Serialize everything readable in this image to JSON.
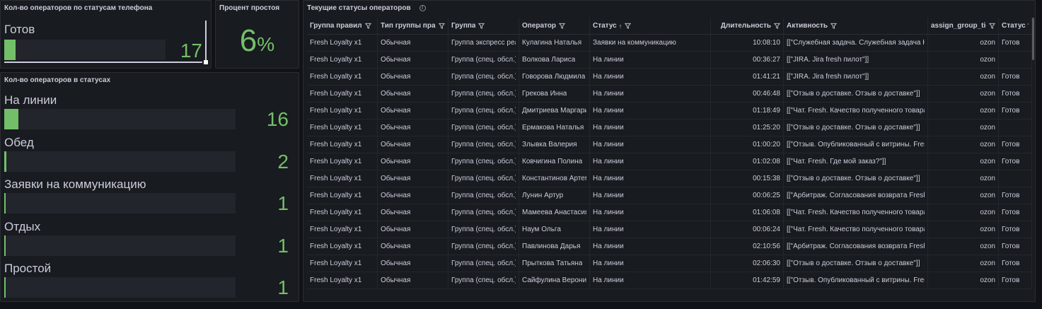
{
  "colors": {
    "accent": "#73bf69",
    "panel_bg": "#181b1f",
    "page_bg": "#111217"
  },
  "phone_status_panel": {
    "title": "Кол-во операторов по статусам телефона",
    "items": [
      {
        "label": "Готов",
        "value": "17",
        "fraction": 0.07
      }
    ]
  },
  "idle_panel": {
    "title": "Процент простоя",
    "value": "6",
    "unit": "%"
  },
  "status_panel": {
    "title": "Кол-во операторов в статусах",
    "items": [
      {
        "label": "На линии",
        "value": "16",
        "fraction": 0.06
      },
      {
        "label": "Обед",
        "value": "2",
        "fraction": 0.008
      },
      {
        "label": "Заявки на коммуникацию",
        "value": "1",
        "fraction": 0.004
      },
      {
        "label": "Отдых",
        "value": "1",
        "fraction": 0.004
      },
      {
        "label": "Простой",
        "value": "1",
        "fraction": 0.004
      }
    ]
  },
  "table_panel": {
    "title": "Текущие статусы операторов",
    "info_icon": "i",
    "columns": [
      {
        "label": "Группа правил",
        "filter": true
      },
      {
        "label": "Тип группы прав",
        "filter": true
      },
      {
        "label": "Группа",
        "filter": true
      },
      {
        "label": "Оператор",
        "filter": true
      },
      {
        "label": "Статус",
        "filter": true,
        "sort": "↑"
      },
      {
        "label": "Длительность",
        "filter": true
      },
      {
        "label": "Активность",
        "filter": true
      },
      {
        "label": "assign_group_ticl",
        "filter": true
      },
      {
        "label": "Статус теле",
        "filter": false
      }
    ],
    "rows": [
      [
        "Fresh Loyalty x1",
        "Обычная",
        "Группа экспресс реакции",
        "Кулагина Наталья",
        "Заявки на коммуникацию",
        "10:08:10",
        "[[\"Служебная задача. Служебная задача КС\"]]",
        "ozon",
        "Готов"
      ],
      [
        "Fresh Loyalty x1",
        "Обычная",
        "Группа (спец. обсл.)",
        "Волкова Лариса",
        "На линии",
        "00:36:27",
        "[[\"JIRA. Jira fresh пилот\"]]",
        "ozon",
        ""
      ],
      [
        "Fresh Loyalty x1",
        "Обычная",
        "Группа (спец. обсл.)",
        "Говорова Людмила",
        "На линии",
        "01:41:21",
        "[[\"JIRA. Jira fresh пилот\"]]",
        "ozon",
        "Готов"
      ],
      [
        "Fresh Loyalty x1",
        "Обычная",
        "Группа (спец. обсл.)",
        "Грекова Инна",
        "На линии",
        "00:46:48",
        "[[\"Отзыв о доставке. Отзыв о доставке\"]]",
        "ozon",
        "Готов"
      ],
      [
        "Fresh Loyalty x1",
        "Обычная",
        "Группа (спец. обсл.)",
        "Дмитриева Маргарита",
        "На линии",
        "01:18:49",
        "[[\"Чат. Fresh. Качество полученного товара\"]]",
        "ozon",
        "Готов"
      ],
      [
        "Fresh Loyalty x1",
        "Обычная",
        "Группа (спец. обсл.)",
        "Ермакова Наталья",
        "На линии",
        "01:25:20",
        "[[\"Отзыв о доставке. Отзыв о доставке\"]]",
        "ozon",
        ""
      ],
      [
        "Fresh Loyalty x1",
        "Обычная",
        "Группа (спец. обсл.)",
        "Злывка Валерия",
        "На линии",
        "01:00:20",
        "[[\"Отзыв. Опубликованный с витрины. Fresh\"]]",
        "ozon",
        "Готов"
      ],
      [
        "Fresh Loyalty x1",
        "Обычная",
        "Группа (спец. обсл.)",
        "Ковчигина Полина",
        "На линии",
        "01:02:08",
        "[[\"Чат. Fresh. Где мой заказ?\"]]",
        "ozon",
        "Готов"
      ],
      [
        "Fresh Loyalty x1",
        "Обычная",
        "Группа (спец. обсл.)",
        "Константинов Артем",
        "На линии",
        "00:15:38",
        "[[\"Отзыв о доставке. Отзыв о доставке\"]]",
        "ozon",
        ""
      ],
      [
        "Fresh Loyalty x1",
        "Обычная",
        "Группа (спец. обсл.)",
        "Лунин Артур",
        "На линии",
        "00:06:25",
        "[[\"Арбитраж. Согласования возврата Fresh\"]]",
        "ozon",
        "Готов"
      ],
      [
        "Fresh Loyalty x1",
        "Обычная",
        "Группа (спец. обсл.)",
        "Мамеева Анастасия",
        "На линии",
        "01:06:08",
        "[[\"Чат. Fresh. Качество полученного товара\"]]",
        "ozon",
        "Готов"
      ],
      [
        "Fresh Loyalty x1",
        "Обычная",
        "Группа (спец. обсл.)",
        "Наум Ольга",
        "На линии",
        "00:06:24",
        "[[\"Чат. Fresh. Качество полученного товара\"]]",
        "ozon",
        "Готов"
      ],
      [
        "Fresh Loyalty x1",
        "Обычная",
        "Группа (спец. обсл.)",
        "Павлинова Дарья",
        "На линии",
        "02:10:56",
        "[[\"Арбитраж. Согласования возврата Fresh\"]]",
        "ozon",
        "Готов"
      ],
      [
        "Fresh Loyalty x1",
        "Обычная",
        "Группа (спец. обсл.)",
        "Прыткова Татьяна",
        "На линии",
        "02:06:30",
        "[[\"Отзыв о доставке. Отзыв о доставке\"]]",
        "ozon",
        "Готов"
      ],
      [
        "Fresh Loyalty x1",
        "Обычная",
        "Группа (спец. обсл.)",
        "Сайфулина Вероника",
        "На линии",
        "01:42:59",
        "[[\"Отзыв. Опубликованный с витрины. Fresh\"]]",
        "ozon",
        "Готов"
      ]
    ]
  }
}
